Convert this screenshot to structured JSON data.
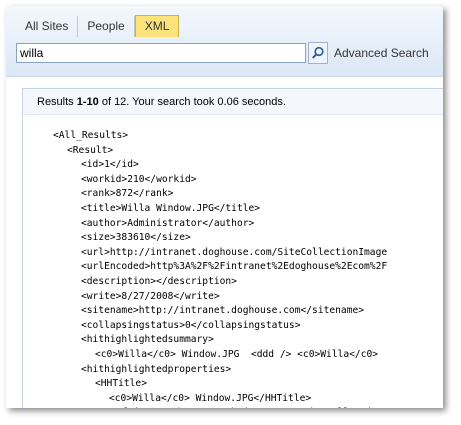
{
  "tabs": [
    {
      "label": "All Sites",
      "active": false
    },
    {
      "label": "People",
      "active": false
    },
    {
      "label": "XML",
      "active": true
    }
  ],
  "search": {
    "value": "willa",
    "button_icon": "search-icon",
    "advanced_label": "Advanced Search"
  },
  "results": {
    "prefix": "Results ",
    "range": "1-10",
    "middle": " of 12. Your search took 0.06 seconds."
  },
  "colors": {
    "active_tab": "#fbe27b",
    "band": "#dbe7f5"
  },
  "xml_lines": [
    {
      "indent": 0,
      "text": "<All_Results>"
    },
    {
      "indent": 1,
      "text": "<Result>"
    },
    {
      "indent": 2,
      "text": "<id>1</id>"
    },
    {
      "indent": 2,
      "text": "<workid>210</workid>"
    },
    {
      "indent": 2,
      "text": "<rank>872</rank>"
    },
    {
      "indent": 2,
      "text": "<title>Willa Window.JPG</title>"
    },
    {
      "indent": 2,
      "text": "<author>Administrator</author>"
    },
    {
      "indent": 2,
      "text": "<size>383610</size>"
    },
    {
      "indent": 2,
      "text": "<url>http://intranet.doghouse.com/SiteCollectionImage"
    },
    {
      "indent": 2,
      "text": "<urlEncoded>http%3A%2F%2Fintranet%2Edoghouse%2Ecom%2F"
    },
    {
      "indent": 2,
      "text": "<description></description>"
    },
    {
      "indent": 2,
      "text": "<write>8/27/2008</write>"
    },
    {
      "indent": 2,
      "text": "<sitename>http://intranet.doghouse.com</sitename>"
    },
    {
      "indent": 2,
      "text": "<collapsingstatus>0</collapsingstatus>"
    },
    {
      "indent": 2,
      "text": "<hithighlightedsummary>"
    },
    {
      "indent": 3,
      "text": "<c0>Willa</c0> Window.JPG  <ddd /> <c0>Willa</c0>"
    },
    {
      "indent": 2,
      "text": "<hithighlightedproperties>"
    },
    {
      "indent": 3,
      "text": "<HHTitle>"
    },
    {
      "indent": 4,
      "text": "<c0>Willa</c0> Window.JPG</HHTitle>"
    },
    {
      "indent": 3,
      "text": "<HHUrl>http://intranet.doghouse.com/SiteCollection"
    }
  ]
}
